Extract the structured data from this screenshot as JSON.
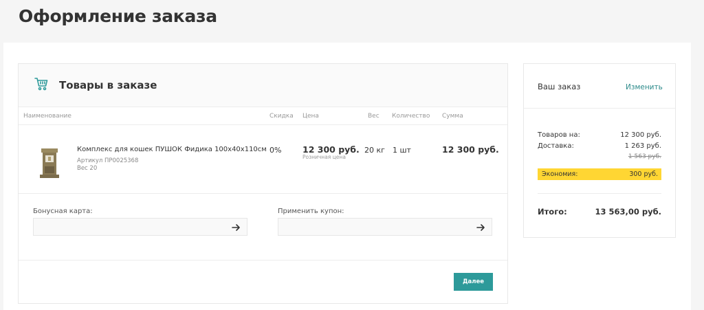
{
  "page": {
    "title": "Оформление заказа"
  },
  "cart": {
    "title": "Товары в заказе",
    "columns": {
      "name": "Наименование",
      "discount": "Скидка",
      "price": "Цена",
      "weight": "Вес",
      "quantity": "Количество",
      "sum": "Сумма"
    },
    "item": {
      "name": "Комплекс для кошек ПУШОК Фидика 100х40х110см",
      "article": "Артикул  ПР0025368",
      "weight_meta": "Вес  20",
      "discount": "0%",
      "price": "12 300 руб.",
      "price_note": "Розничная цена",
      "weight": "20 кг",
      "quantity": "1 шт",
      "sum": "12 300 руб."
    },
    "bonus_label": "Бонусная карта:",
    "coupon_label": "Применить купон:",
    "bonus_value": "",
    "coupon_value": "",
    "next_label": "Далее"
  },
  "summary": {
    "title": "Ваш заказ",
    "edit_label": "Изменить",
    "goods_label": "Товаров на:",
    "goods_value": "12 300 руб.",
    "delivery_label": "Доставка:",
    "delivery_value": "1 263 руб.",
    "delivery_old": "1 563 руб.",
    "savings_label": "Экономия:",
    "savings_value": "300 руб.",
    "total_label": "Итого:",
    "total_value": "13 563,00 руб."
  },
  "colors": {
    "accent": "#2d9a9a",
    "savings_bg": "#ffd633"
  },
  "icons": {
    "cart": "shopping-cart-icon",
    "arrow": "arrow-right-icon"
  }
}
